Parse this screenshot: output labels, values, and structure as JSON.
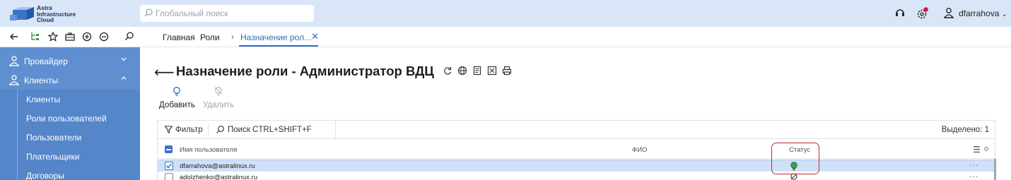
{
  "app": {
    "logo_lines": [
      "Astra",
      "Infrastructure",
      "Cloud"
    ],
    "search_placeholder": "Глобальный поиск",
    "username": "dfarrahova"
  },
  "breadcrumbs": {
    "items": [
      "Главная",
      "Роли"
    ],
    "active_tab": "Назначение рол…",
    "close": "✕"
  },
  "sidebar": {
    "sections": [
      {
        "label": "Провайдер",
        "expanded": false
      },
      {
        "label": "Клиенты",
        "expanded": true
      }
    ],
    "sub_items": [
      "Клиенты",
      "Роли пользователей",
      "Пользователи",
      "Плательщики",
      "Договоры"
    ]
  },
  "page": {
    "title": "Назначение роли - Администратор ВДЦ",
    "actions": {
      "add": "Добавить",
      "delete": "Удалить"
    }
  },
  "grid": {
    "filter_label": "Фильтр",
    "search_label": "Поиск CTRL+SHIFT+F",
    "selected_text": "Выделено: 1",
    "columns": {
      "username": "Имя пользователя",
      "fio": "ФИО",
      "status": "Статус"
    },
    "rows": [
      {
        "username": "dfarrahova@astralinux.ru",
        "fio": "",
        "status": "active",
        "checked": true
      },
      {
        "username": "adolzhenko@astralinux.ru",
        "fio": "",
        "status": "disabled",
        "checked": false
      }
    ],
    "more": "···"
  },
  "colors": {
    "topbar": "#d8e6f8",
    "sidebar": "#5f8fd0",
    "accent": "#2a70c0",
    "selected_row": "#cfe0f7",
    "highlight": "#c6282f"
  }
}
